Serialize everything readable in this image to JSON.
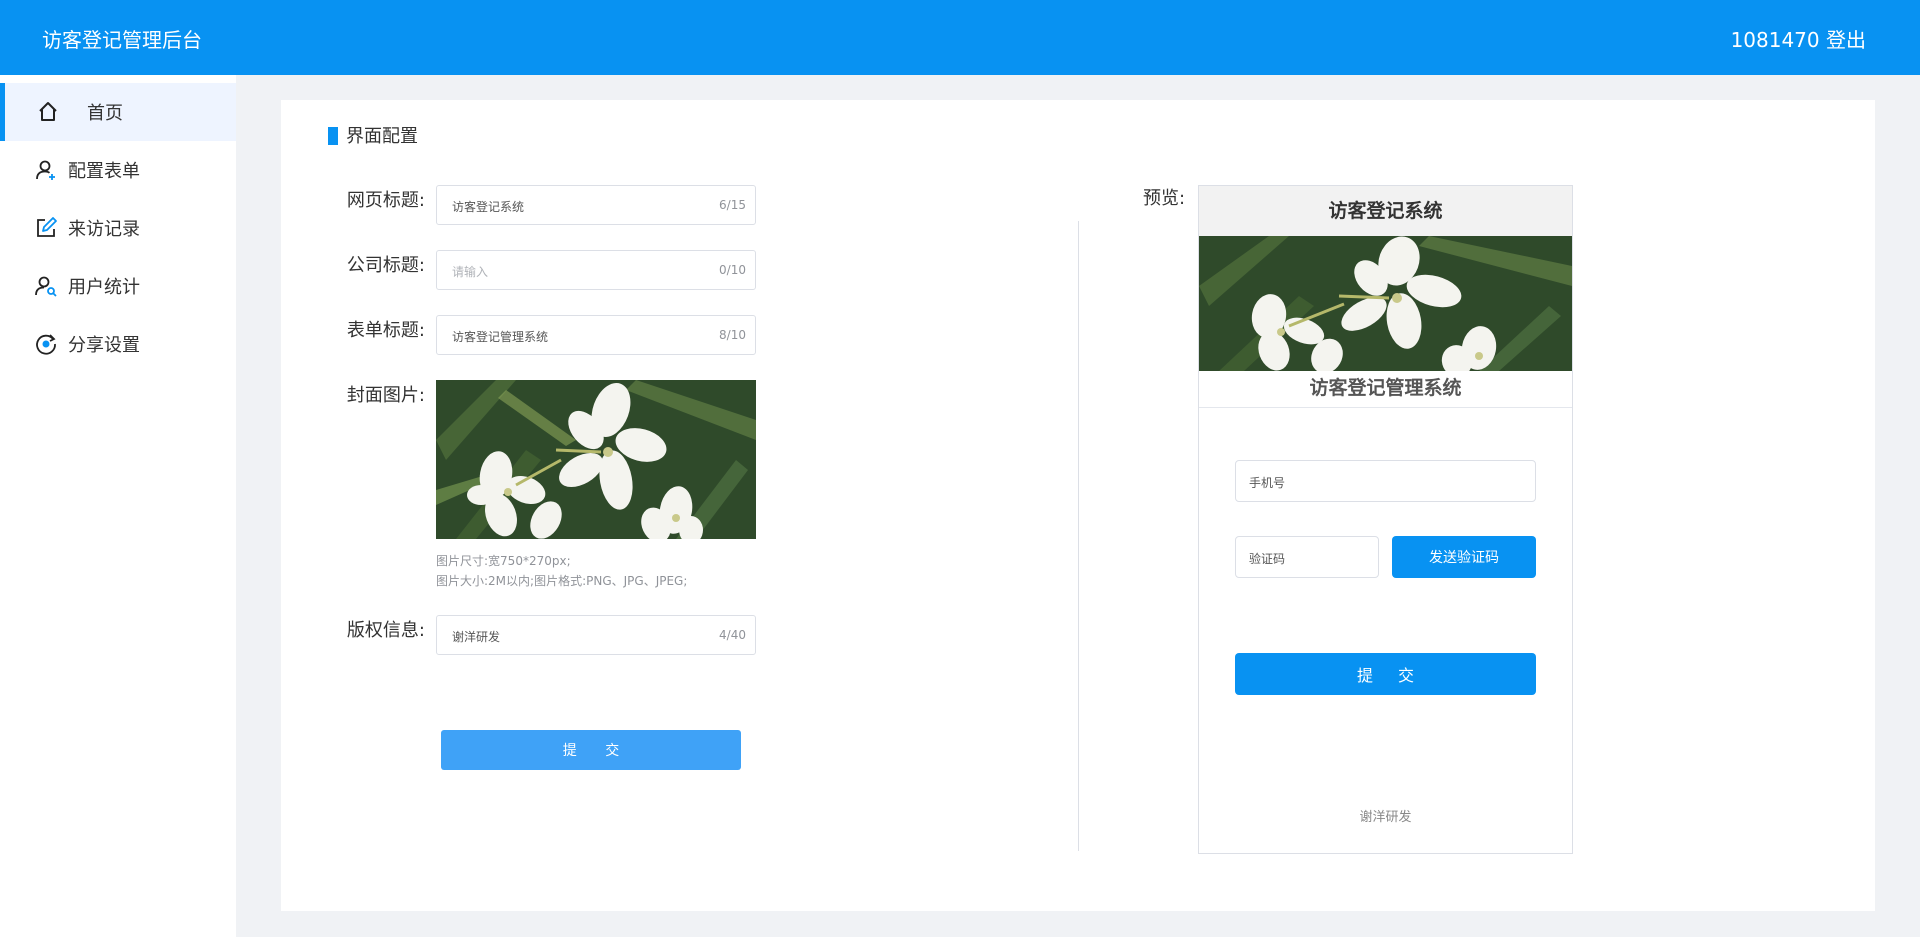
{
  "header": {
    "app_title": "访客登记管理后台",
    "user_id": "1081470",
    "logout": "登出"
  },
  "sidebar": {
    "items": [
      {
        "label": "首页",
        "icon": "home-icon",
        "active": true
      },
      {
        "label": "配置表单",
        "icon": "user-add-icon",
        "active": false
      },
      {
        "label": "来访记录",
        "icon": "edit-icon",
        "active": false
      },
      {
        "label": "用户统计",
        "icon": "user-search-icon",
        "active": false
      },
      {
        "label": "分享设置",
        "icon": "share-icon",
        "active": false
      }
    ]
  },
  "main": {
    "section_title": "界面配置",
    "form": {
      "page_title": {
        "label": "网页标题:",
        "value": "访客登记系统",
        "count": "6/15"
      },
      "company_title": {
        "label": "公司标题:",
        "placeholder": "请输入",
        "count": "0/10"
      },
      "form_title": {
        "label": "表单标题:",
        "value": "访客登记管理系统",
        "count": "8/10"
      },
      "cover": {
        "label": "封面图片:",
        "hint1": "图片尺寸:宽750*270px;",
        "hint2": "图片大小:2M以内;图片格式:PNG、JPG、JPEG;"
      },
      "copyright": {
        "label": "版权信息:",
        "value": "谢洋研发",
        "count": "4/40"
      },
      "submit": "提 交"
    },
    "preview": {
      "label": "预览:",
      "title": "访客登记系统",
      "form_title": "访客登记管理系统",
      "phone_placeholder": "手机号",
      "code_placeholder": "验证码",
      "send_code": "发送验证码",
      "submit": "提 交",
      "copyright": "谢洋研发"
    }
  },
  "colors": {
    "primary": "#0892f2",
    "submit_light": "#3fa2f7",
    "sidebar_active_bg": "#eef4ff"
  }
}
